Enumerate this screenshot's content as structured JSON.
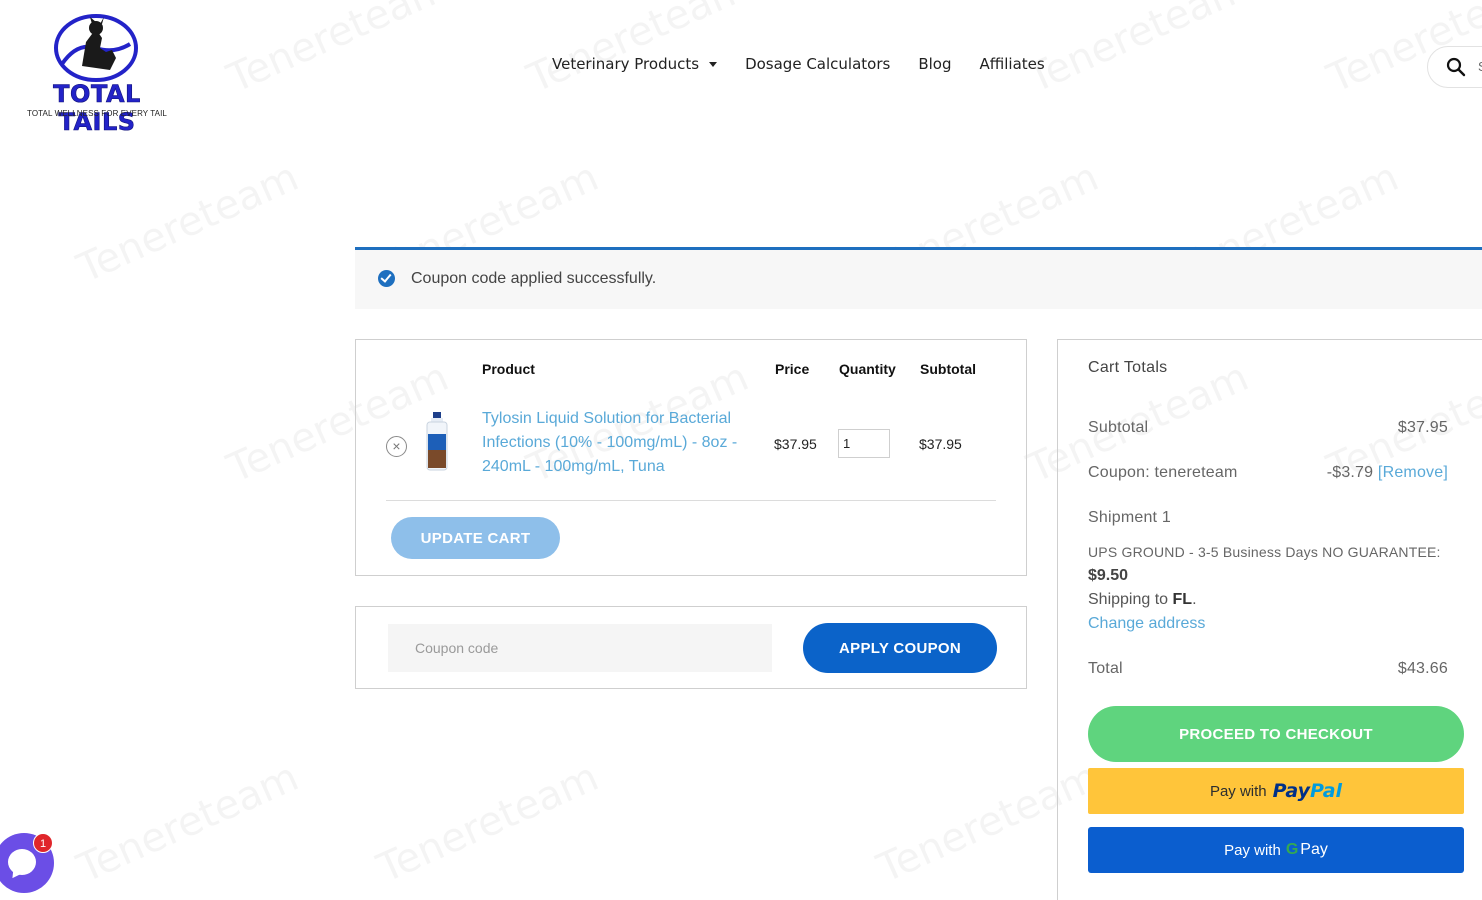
{
  "brand": {
    "name": "TOTAL TAILS",
    "tagline": "TOTAL WELLNESS FOR EVERY TAIL"
  },
  "nav": {
    "items": [
      {
        "label": "Veterinary Products",
        "has_dropdown": true
      },
      {
        "label": "Dosage Calculators",
        "has_dropdown": false
      },
      {
        "label": "Blog",
        "has_dropdown": false
      },
      {
        "label": "Affiliates",
        "has_dropdown": false
      }
    ],
    "search_placeholder": "S"
  },
  "notice": {
    "message": "Coupon code applied successfully."
  },
  "cart": {
    "headers": {
      "product": "Product",
      "price": "Price",
      "quantity": "Quantity",
      "subtotal": "Subtotal"
    },
    "items": [
      {
        "name": "Tylosin Liquid Solution for Bacterial Infections (10% - 100mg/mL) - 8oz - 240mL - 100mg/mL, Tuna",
        "price": "$37.95",
        "quantity": "1",
        "subtotal": "$37.95",
        "remove_glyph": "×"
      }
    ],
    "update_label": "UPDATE CART"
  },
  "coupon": {
    "placeholder": "Coupon code",
    "apply_label": "APPLY COUPON"
  },
  "totals": {
    "heading": "Cart Totals",
    "subtotal_label": "Subtotal",
    "subtotal_value": "$37.95",
    "coupon_label": "Coupon: tenereteam",
    "coupon_value": "-$3.79",
    "coupon_remove": "[Remove]",
    "shipment_label": "Shipment 1",
    "shipping_method": "UPS GROUND - 3-5 Business Days NO GUARANTEE:",
    "shipping_cost": "$9.50",
    "shipping_to_prefix": "Shipping to",
    "shipping_to_state": "FL",
    "change_address": "Change address",
    "total_label": "Total",
    "total_value": "$43.66",
    "checkout_label": "PROCEED TO CHECKOUT",
    "paypal_prefix": "Pay with",
    "paypal_brand_1": "Pay",
    "paypal_brand_2": "Pal",
    "gpay_prefix": "Pay with",
    "gpay_g": "G",
    "gpay_brand": "Pay"
  },
  "chat": {
    "badge_count": "1"
  },
  "watermark": "Tenereteam",
  "colors": {
    "brand_blue": "#2323c8",
    "notice_accent": "#1e6fbf",
    "link": "#59a9d8",
    "update_btn": "#8ebfea",
    "apply_btn": "#0b63c9",
    "checkout_btn": "#5fd47e",
    "paypal_btn": "#ffc53a",
    "gpay_btn": "#0b5ecf",
    "chat": "#6b4ee6",
    "badge": "#e0262b"
  }
}
